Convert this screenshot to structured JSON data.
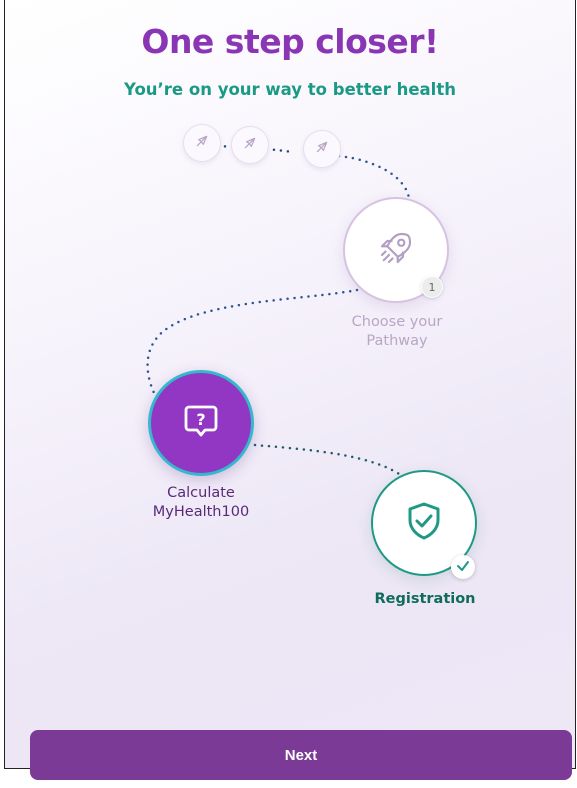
{
  "header": {
    "title": "One step closer!",
    "subtitle": "You’re on your way to better health"
  },
  "steps": {
    "pathway": {
      "label": "Choose your\nPathway",
      "badge": "1",
      "icon": "rocket-icon"
    },
    "calculate": {
      "label": "Calculate\nMyHealth100",
      "icon": "question-chat-icon"
    },
    "registration": {
      "label": "Registration",
      "icon": "shield-check-icon",
      "badge_icon": "check-icon"
    }
  },
  "footer": {
    "next_label": "Next"
  },
  "colors": {
    "title": "#8a35b4",
    "subtitle": "#1a9a86",
    "accent_purple": "#9237c4",
    "accent_teal": "#1f9985",
    "button": "#7a3a96"
  }
}
